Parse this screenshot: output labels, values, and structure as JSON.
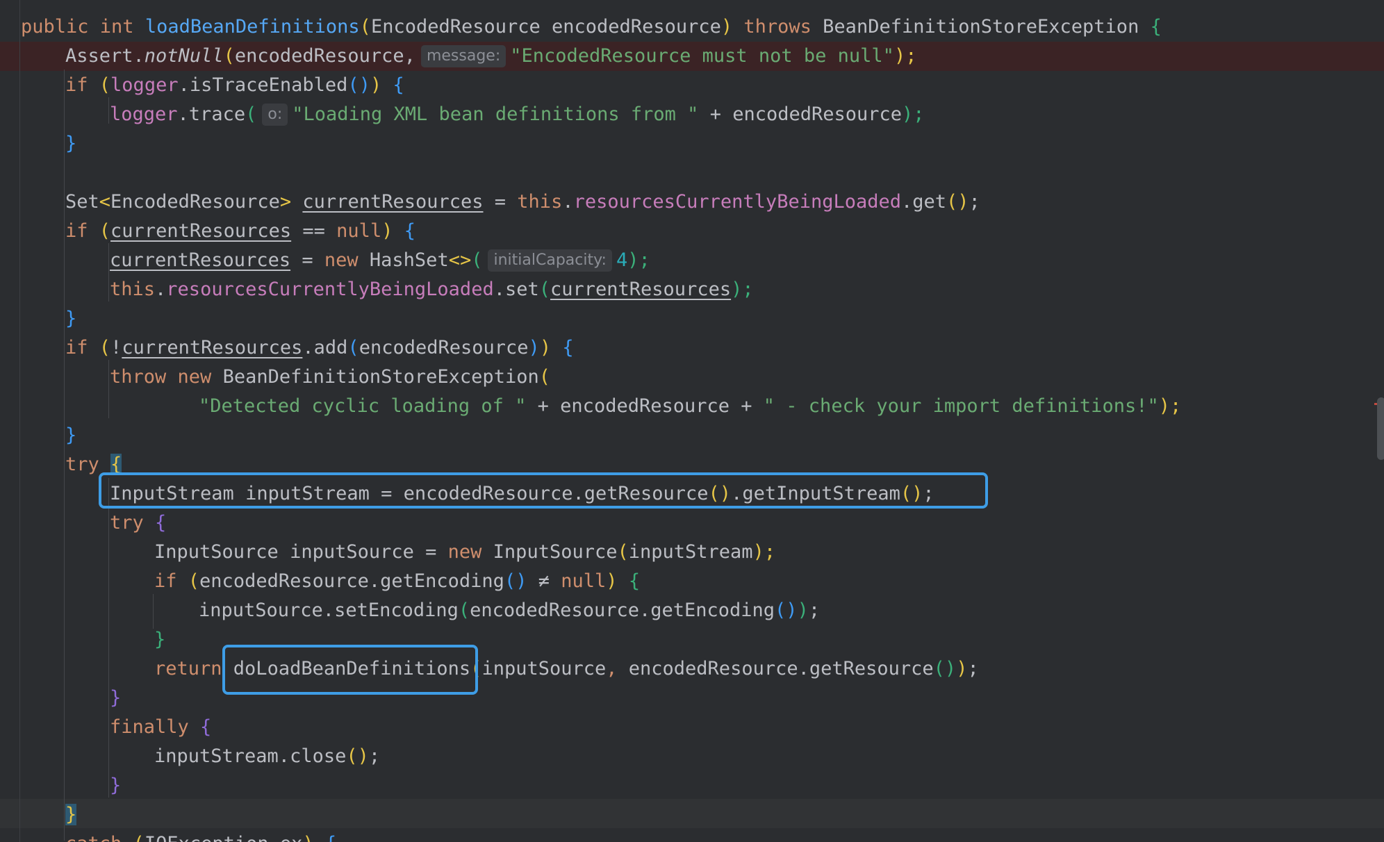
{
  "editor": {
    "lines": {
      "l1": {
        "t1": "public int ",
        "t2": "loadBeanDefinitions",
        "t3": "(",
        "t4": "EncodedResource encodedResource",
        "t5": ")",
        "t6": " throws ",
        "t7": "BeanDefinitionStoreException ",
        "t8": "{"
      },
      "l2": {
        "t1": "Assert.",
        "t2": "notNull",
        "t3": "(",
        "t4": "encodedResource,",
        "hint": "message:",
        "t5": "\"EncodedResource must not be null\"",
        "t6": ");"
      },
      "l3": {
        "t1": "if ",
        "t2": "(",
        "t3": "logger",
        "t4": ".isTraceEnabled",
        "t5": "()",
        "t6": ")",
        "t7": " ",
        "t8": "{"
      },
      "l4": {
        "t1": "logger",
        "t2": ".trace",
        "t3": "(",
        "hint": "o:",
        "t4": "\"Loading XML bean definitions from \"",
        "t5": " + encodedResource",
        "t6": ");"
      },
      "l5": {
        "t1": "}"
      },
      "l6": {
        "t1": "Set",
        "t2": "<",
        "t3": "EncodedResource",
        "t4": ">",
        "t5": " ",
        "t6": "currentResources",
        "t7": " = ",
        "t8": "this",
        "t9": ".",
        "t10": "resourcesCurrentlyBeingLoaded",
        "t11": ".get",
        "t12": "()",
        "t13": ";"
      },
      "l7": {
        "t1": "if ",
        "t2": "(",
        "t3": "currentResources",
        "t4": " == ",
        "t5": "null",
        "t6": ")",
        "t7": " ",
        "t8": "{"
      },
      "l8": {
        "t1": "currentResources",
        "t2": " = ",
        "t3": "new ",
        "t4": "HashSet",
        "t5": "<>",
        "t6": "(",
        "hint": "initialCapacity:",
        "t7": "4",
        "t8": ");"
      },
      "l9": {
        "t1": "this",
        "t2": ".",
        "t3": "resourcesCurrentlyBeingLoaded",
        "t4": ".set",
        "t5": "(",
        "t6": "currentResources",
        "t7": ");"
      },
      "l10": {
        "t1": "}"
      },
      "l11": {
        "t1": "if ",
        "t2": "(",
        "t3": "!",
        "t4": "currentResources",
        "t5": ".add",
        "t6": "(",
        "t7": "encodedResource",
        "t8": ")",
        "t9": ")",
        "t10": " ",
        "t11": "{"
      },
      "l12": {
        "t1": "throw new ",
        "t2": "BeanDefinitionStoreException",
        "t3": "("
      },
      "l13": {
        "t1": "\"Detected cyclic loading of \"",
        "t2": " + encodedResource + ",
        "t3": "\" - check your import definitions!\"",
        "t4": ");"
      },
      "l14": {
        "t1": "}"
      },
      "l15": {
        "t1": "try ",
        "t2": "{"
      },
      "l16": {
        "t1": "InputStream inputStream = encodedResource.getResource",
        "t2": "()",
        "t3": ".getInputStream",
        "t4": "()",
        "t5": ";"
      },
      "l17": {
        "t1": "try ",
        "t2": "{"
      },
      "l18": {
        "t1": "InputSource inputSource = ",
        "t2": "new ",
        "t3": "InputSource",
        "t4": "(",
        "t5": "inputStream",
        "t6": ");"
      },
      "l19": {
        "t1": "if ",
        "t2": "(",
        "t3": "encodedResource.getEncoding",
        "t4": "()",
        "t5": " ≠ ",
        "t6": "null",
        "t7": ")",
        "t8": " ",
        "t9": "{"
      },
      "l20": {
        "t1": "inputSource.setEncoding",
        "t2": "(",
        "t3": "encodedResource.getEncoding",
        "t4": "()",
        "t5": ")",
        "t6": ";"
      },
      "l21": {
        "t1": "}"
      },
      "l22": {
        "t1": "return ",
        "t2": "doLoadBeanDefinitions",
        "t3": "(",
        "t4": "inputSource",
        "t5": ", ",
        "t6": "encodedResource.getResource",
        "t7": "()",
        "t8": ")",
        "t9": ";"
      },
      "l23": {
        "t1": "}"
      },
      "l24": {
        "t1": "finally ",
        "t2": "{"
      },
      "l25": {
        "t1": "inputStream.close",
        "t2": "()",
        "t3": ";"
      },
      "l26": {
        "t1": "}"
      },
      "l27": {
        "t1": "}"
      },
      "l28": {
        "t1": "catch ",
        "t2": "(",
        "t3": "IOException ex",
        "t4": ")",
        "t5": " ",
        "t6": "{"
      }
    }
  },
  "colors": {
    "background": "#2b2d30",
    "keyword": "#cf8e6d",
    "method_declaration": "#56a8f5",
    "field": "#c77dbb",
    "string": "#6aab73",
    "number": "#2aacb8",
    "annotation_box": "#3e9de6",
    "error_line_highlight": "#3b2325"
  }
}
